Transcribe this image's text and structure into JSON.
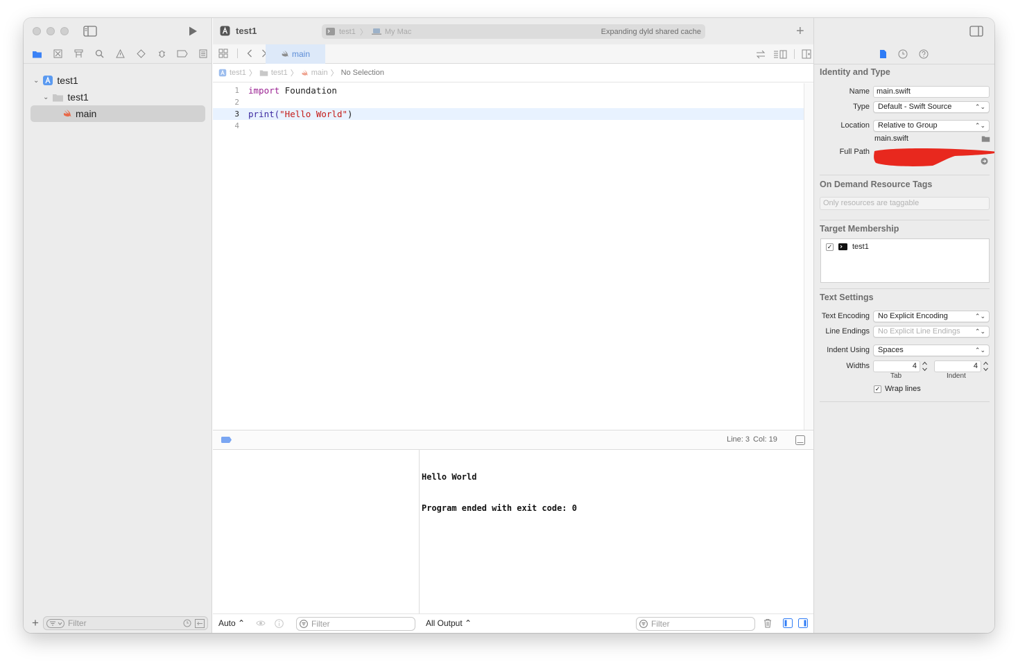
{
  "project": {
    "name": "test1"
  },
  "status": {
    "scheme": "test1",
    "destination": "My Mac",
    "message": "Expanding dyld shared cache"
  },
  "navigator": {
    "tree": [
      {
        "label": "test1",
        "kind": "project"
      },
      {
        "label": "test1",
        "kind": "group"
      },
      {
        "label": "main",
        "kind": "file",
        "selected": true
      }
    ],
    "filter_placeholder": "Filter"
  },
  "editor": {
    "tab_label": "main",
    "jumpbar": [
      "test1",
      "test1",
      "main",
      "No Selection"
    ],
    "lines": [
      {
        "num": "1",
        "keyword": "import",
        "text": " Foundation"
      },
      {
        "num": "2",
        "text": ""
      },
      {
        "num": "3",
        "func": "print(",
        "string": "\"Hello World\"",
        "tail": ")"
      },
      {
        "num": "4",
        "text": ""
      }
    ],
    "position": {
      "line": "Line: 3",
      "col": "Col: 19"
    }
  },
  "console": {
    "output_lines": [
      "Hello World",
      "Program ended with exit code: 0"
    ],
    "variables_scope": "Auto ⌃",
    "output_scope": "All Output ⌃",
    "filter_placeholder": "Filter"
  },
  "inspector": {
    "identity_title": "Identity and Type",
    "name_label": "Name",
    "name_value": "main.swift",
    "type_label": "Type",
    "type_value": "Default - Swift Source",
    "location_label": "Location",
    "location_value": "Relative to Group",
    "location_file": "main.swift",
    "fullpath_label": "Full Path",
    "odr_title": "On Demand Resource Tags",
    "odr_placeholder": "Only resources are taggable",
    "target_title": "Target Membership",
    "target_name": "test1",
    "text_title": "Text Settings",
    "encoding_label": "Text Encoding",
    "encoding_value": "No Explicit Encoding",
    "endings_label": "Line Endings",
    "endings_value": "No Explicit Line Endings",
    "indent_label": "Indent Using",
    "indent_value": "Spaces",
    "widths_label": "Widths",
    "tab_value": "4",
    "indent_width_value": "4",
    "tab_caption": "Tab",
    "indent_caption": "Indent",
    "wrap_label": "Wrap lines"
  },
  "colors": {
    "accent": "#2f7cf6",
    "redaction": "#e8281e"
  }
}
